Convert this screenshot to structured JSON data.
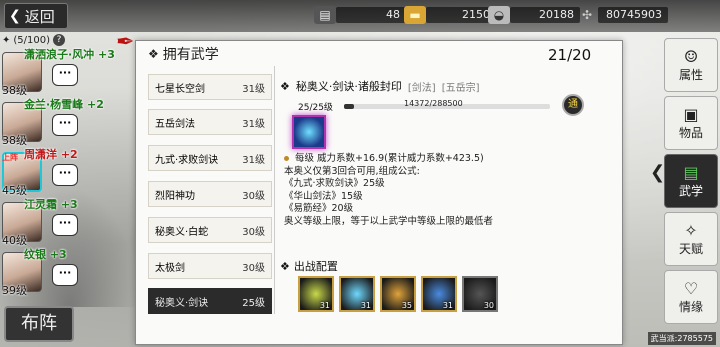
{
  "topbar": {
    "back_label": "返回",
    "resources": [
      {
        "icon": "chest-icon",
        "value": "48"
      },
      {
        "icon": "gold-bar-icon",
        "value": "2150"
      },
      {
        "icon": "silver-ingot-icon",
        "value": "20188"
      },
      {
        "icon": "coin-icon",
        "value": "80745903"
      }
    ]
  },
  "team": {
    "count": "(5/100)",
    "help": "?",
    "heroes": [
      {
        "name": "潇洒浪子·风冲 +3",
        "level": "38级",
        "chat": "···",
        "tag": ""
      },
      {
        "name": "金兰·杨雪峰 +2",
        "level": "38级",
        "chat": "···",
        "tag": ""
      },
      {
        "name": "周潇洋 +2",
        "level": "45级",
        "chat": "···",
        "tag": "上阵"
      },
      {
        "name": "江灵霜 +3",
        "level": "40级",
        "chat": "···",
        "tag": ""
      },
      {
        "name": "纹银 +3",
        "level": "39级",
        "chat": "···",
        "tag": ""
      }
    ],
    "formation_label": "布阵"
  },
  "panel": {
    "title": "拥有武学",
    "count": "21/20",
    "skills": [
      {
        "name": "七星长空剑",
        "level": "31级"
      },
      {
        "name": "五岳剑法",
        "level": "31级"
      },
      {
        "name": "九式·求败剑诀",
        "level": "31级"
      },
      {
        "name": "烈阳神功",
        "level": "30级"
      },
      {
        "name": "秘奥义·白蛇",
        "level": "30级"
      },
      {
        "name": "太极剑",
        "level": "30级"
      },
      {
        "name": "秘奥义·剑诀",
        "level": "25级"
      }
    ]
  },
  "detail": {
    "title": "秘奥义·剑诀·诸般封印",
    "tag1": "[剑法]",
    "tag2": "[五岳宗]",
    "level_text": "25/25级",
    "exp_text": "14372/288500",
    "exp_fraction": 0.05,
    "tong": "通",
    "lines": [
      "每级  威力系数+16.9(累计威力系数+423.5)",
      "本奥义仅第3回合可用,组成公式:",
      "《九式·求败剑诀》25级",
      "《华山剑法》15级",
      "《易筋经》20级",
      "奥义等级上限，等于以上武学中等级上限的最低者"
    ],
    "deploy_label": "出战配置",
    "slots": [
      {
        "num": "31",
        "color": "#c9d94a"
      },
      {
        "num": "31",
        "color": "#6fd8ff"
      },
      {
        "num": "35",
        "color": "#e0a33a"
      },
      {
        "num": "31",
        "color": "#4a8be0"
      },
      {
        "num": "30",
        "color": "#555555"
      }
    ]
  },
  "tabs": [
    {
      "label": "属性",
      "icon": "person-icon"
    },
    {
      "label": "物品",
      "icon": "bag-icon"
    },
    {
      "label": "武学",
      "icon": "book-icon"
    },
    {
      "label": "天赋",
      "icon": "fan-icon"
    },
    {
      "label": "情缘",
      "icon": "heart-icon"
    }
  ],
  "footer": "武当派:2785575"
}
